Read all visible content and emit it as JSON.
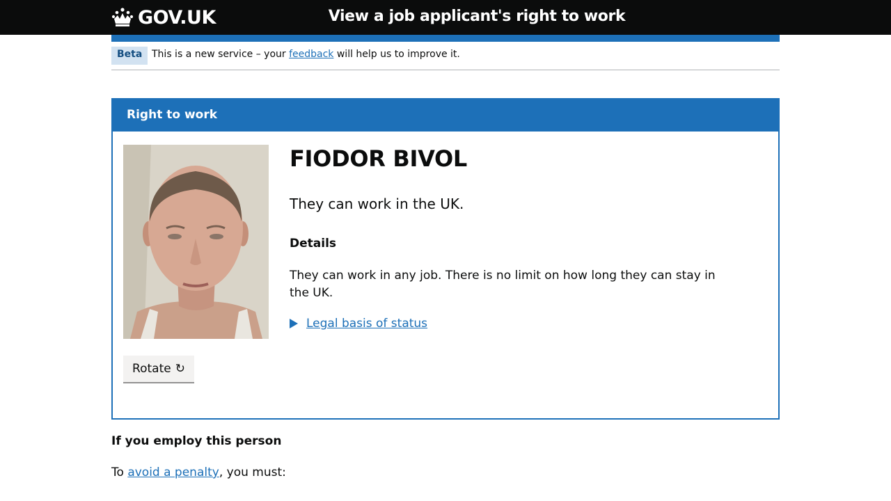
{
  "header": {
    "logo_text": "GOV.UK",
    "service_name": "View a job applicant's right to work"
  },
  "phase_banner": {
    "tag": "Beta",
    "text_before": "This is a new service – your ",
    "link_text": "feedback",
    "text_after": " will help us to improve it."
  },
  "panel": {
    "title": "Right to work",
    "person_name": "FIODOR BIVOL",
    "summary": "They can work in the UK.",
    "details_heading": "Details",
    "details_text": "They can work in any job. There is no limit on how long they can stay in the UK.",
    "legal_link": "Legal basis of status",
    "rotate_label": "Rotate",
    "rotate_icon": "↻"
  },
  "employ": {
    "heading": "If you employ this person",
    "text_before": "To ",
    "link_text": "avoid a penalty",
    "text_after": ", you must:"
  },
  "colors": {
    "header_bg": "#0b0c0c",
    "brand_blue": "#1d70b8",
    "beta_tag_bg": "#d2e2f1",
    "button_bg": "#f3f2f1"
  }
}
